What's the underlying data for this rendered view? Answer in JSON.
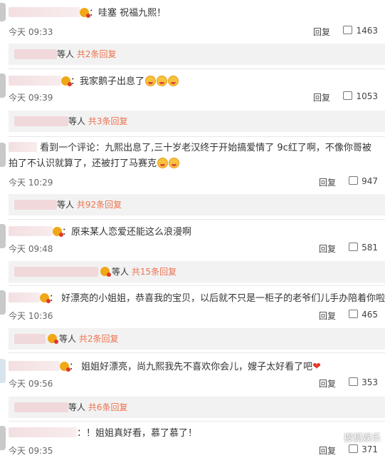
{
  "comments": [
    {
      "text": "：哇塞 祝福九熙！",
      "time": "今天 09:33",
      "reply": "回复",
      "likes": "1463",
      "sub": {
        "label": "等人",
        "count": "共2条回复"
      }
    },
    {
      "text": "：我家鹅子出息了",
      "time": "今天 09:39",
      "reply": "回复",
      "likes": "1053",
      "sub": {
        "label": "等人",
        "count": "共3条回复"
      }
    },
    {
      "text": "看到一个评论：九熙出息了,三十岁老汉终于开始搞爱情了 9c红了啊，不像你哥被拍了不认识就算了，还被打了马赛克",
      "time": "今天 10:29",
      "reply": "回复",
      "likes": "947",
      "sub": {
        "label": "等人",
        "count": "共92条回复"
      }
    },
    {
      "text": "：原来某人恋爱还能这么浪漫啊",
      "time": "今天 09:48",
      "reply": "回复",
      "likes": "581",
      "sub": {
        "label": "等人",
        "count": "共15条回复"
      }
    },
    {
      "text": "好漂亮的小姐姐，恭喜我的宝贝，以后就不只是一柜子的老爷们儿手办陪着你啦",
      "time": "今天 10:36",
      "reply": "回复",
      "likes": "465",
      "sub": {
        "label": "等人",
        "count": "共2条回复"
      }
    },
    {
      "text": "姐姐好漂亮，尚九熙我先不喜欢你会儿，嫂子太好看了吧",
      "time": "今天 09:56",
      "reply": "回复",
      "likes": "353",
      "sub": {
        "label": "等人",
        "count": "共6条回复"
      }
    },
    {
      "text": "：！姐姐真好看，慕了慕了！",
      "time": "今天 09:35",
      "reply": "回复",
      "likes": "371"
    }
  ],
  "watermark": "搜狐娱乐"
}
